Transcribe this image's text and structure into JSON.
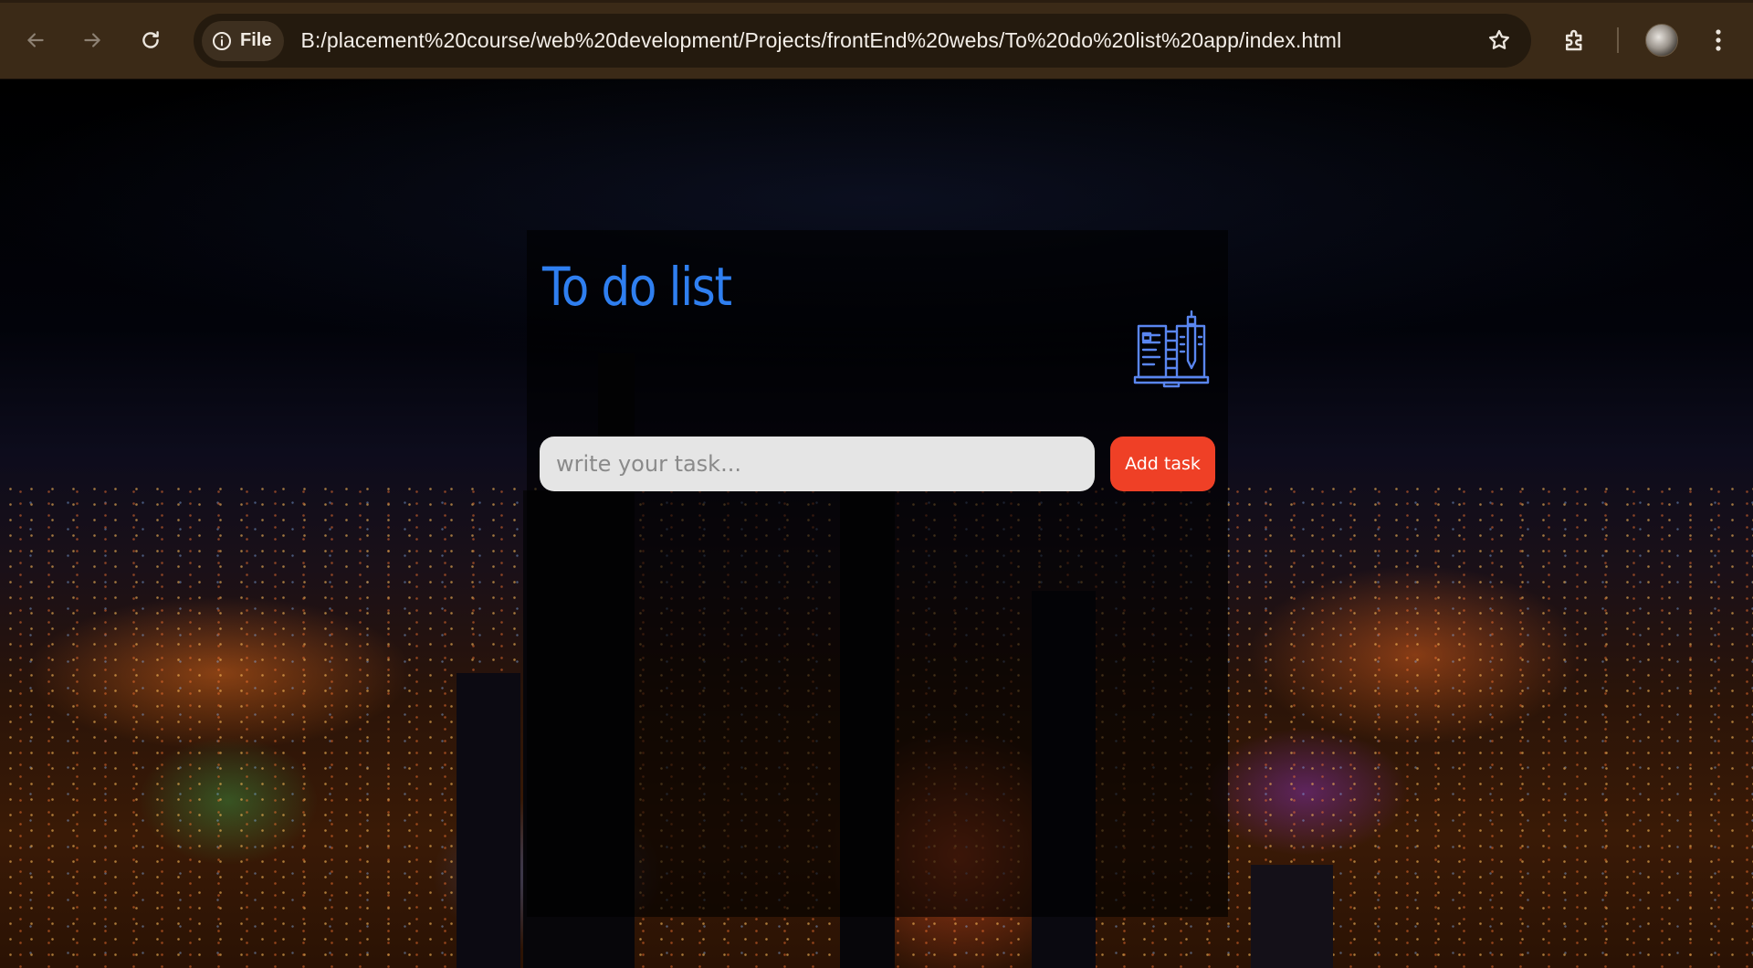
{
  "browser": {
    "site_chip_label": "File",
    "url": "B:/placement%20course/web%20development/Projects/frontEnd%20webs/To%20do%20list%20app/index.html",
    "icons": [
      "back-arrow-icon",
      "forward-arrow-icon",
      "reload-icon",
      "info-icon",
      "star-icon",
      "extensions-icon",
      "profile-avatar",
      "more-menu-icon"
    ]
  },
  "todo": {
    "title": "To do list",
    "input_placeholder": "write your task...",
    "input_value": "",
    "add_button_label": "Add task",
    "icon": "notebook-pen-icon"
  },
  "colors": {
    "title_blue": "#2f7ff0",
    "add_button_red": "#ef4026",
    "input_bg": "#e5e5e5",
    "chrome_bg": "#3b2a17"
  }
}
